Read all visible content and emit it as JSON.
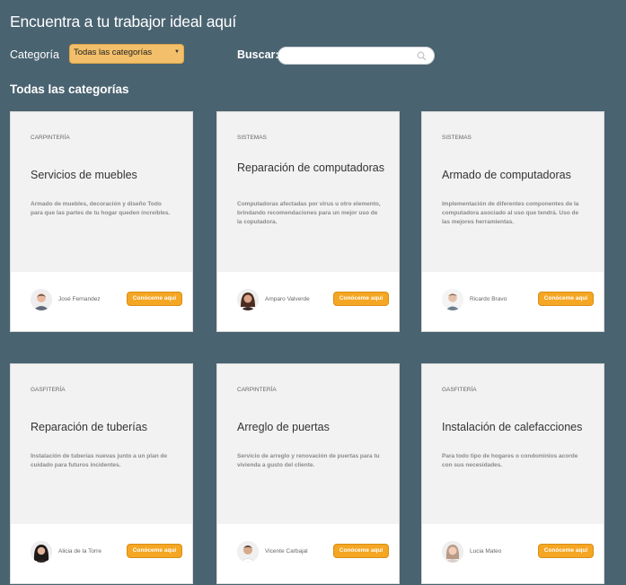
{
  "header": {
    "title": "Encuentra a tu trabajor ideal aquí"
  },
  "filters": {
    "category_label": "Categoría",
    "category_selected": "Todas las categorías",
    "search_label": "Buscar:",
    "search_value": "",
    "search_placeholder": ""
  },
  "section": {
    "heading": "Todas las categorías"
  },
  "cards": [
    {
      "category": "CARPINTERÍA",
      "title": "Servicios de muebles",
      "description": "Armado de muebles, decoración y diseño Todo para que las partes de tu hogar queden increíbles.",
      "author": "José Fernandez",
      "button": "Conóceme aquí"
    },
    {
      "category": "SISTEMAS",
      "title": "Reparación de computadoras",
      "description": "Computadoras afectadas por virus u otro elemento, brindando recomendaciones para un mejor uso de la coputadora.",
      "author": "Amparo Valverde",
      "button": "Conóceme aquí"
    },
    {
      "category": "SISTEMAS",
      "title": "Armado de computadoras",
      "description": "Implementación de diferentes componentes de la computadora asociado al uso que tendrá. Uso de las mejores herramientas.",
      "author": "Ricardo Bravo",
      "button": "Conóceme aquí"
    },
    {
      "category": "GASFITERÍA",
      "title": "Reparación de tuberías",
      "description": "Instalación de tuberías nuevas junto a un plan de cuidado para futuros incidentes.",
      "author": "Alicia de la Torre",
      "button": "Conóceme aquí"
    },
    {
      "category": "CARPINTERÍA",
      "title": "Arreglo de puertas",
      "description": "Servicio de arreglo y renovación de puertas para tu vivienda a gusto del cliente.",
      "author": "Vicente Carbajal",
      "button": "Conóceme aquí"
    },
    {
      "category": "GASFITERÍA",
      "title": "Instalación de calefacciones",
      "description": "Para todo tipo de hogares o condominios acorde con sus necesidades.",
      "author": "Lucia Mateo",
      "button": "Conóceme aquí"
    }
  ],
  "colors": {
    "background": "#4a6370",
    "accent_button": "#f5a623",
    "select_background": "#f3bf6a"
  },
  "icons": {
    "search": "search-icon",
    "dropdown": "chevron-down-icon",
    "avatar": "avatar-icon"
  }
}
